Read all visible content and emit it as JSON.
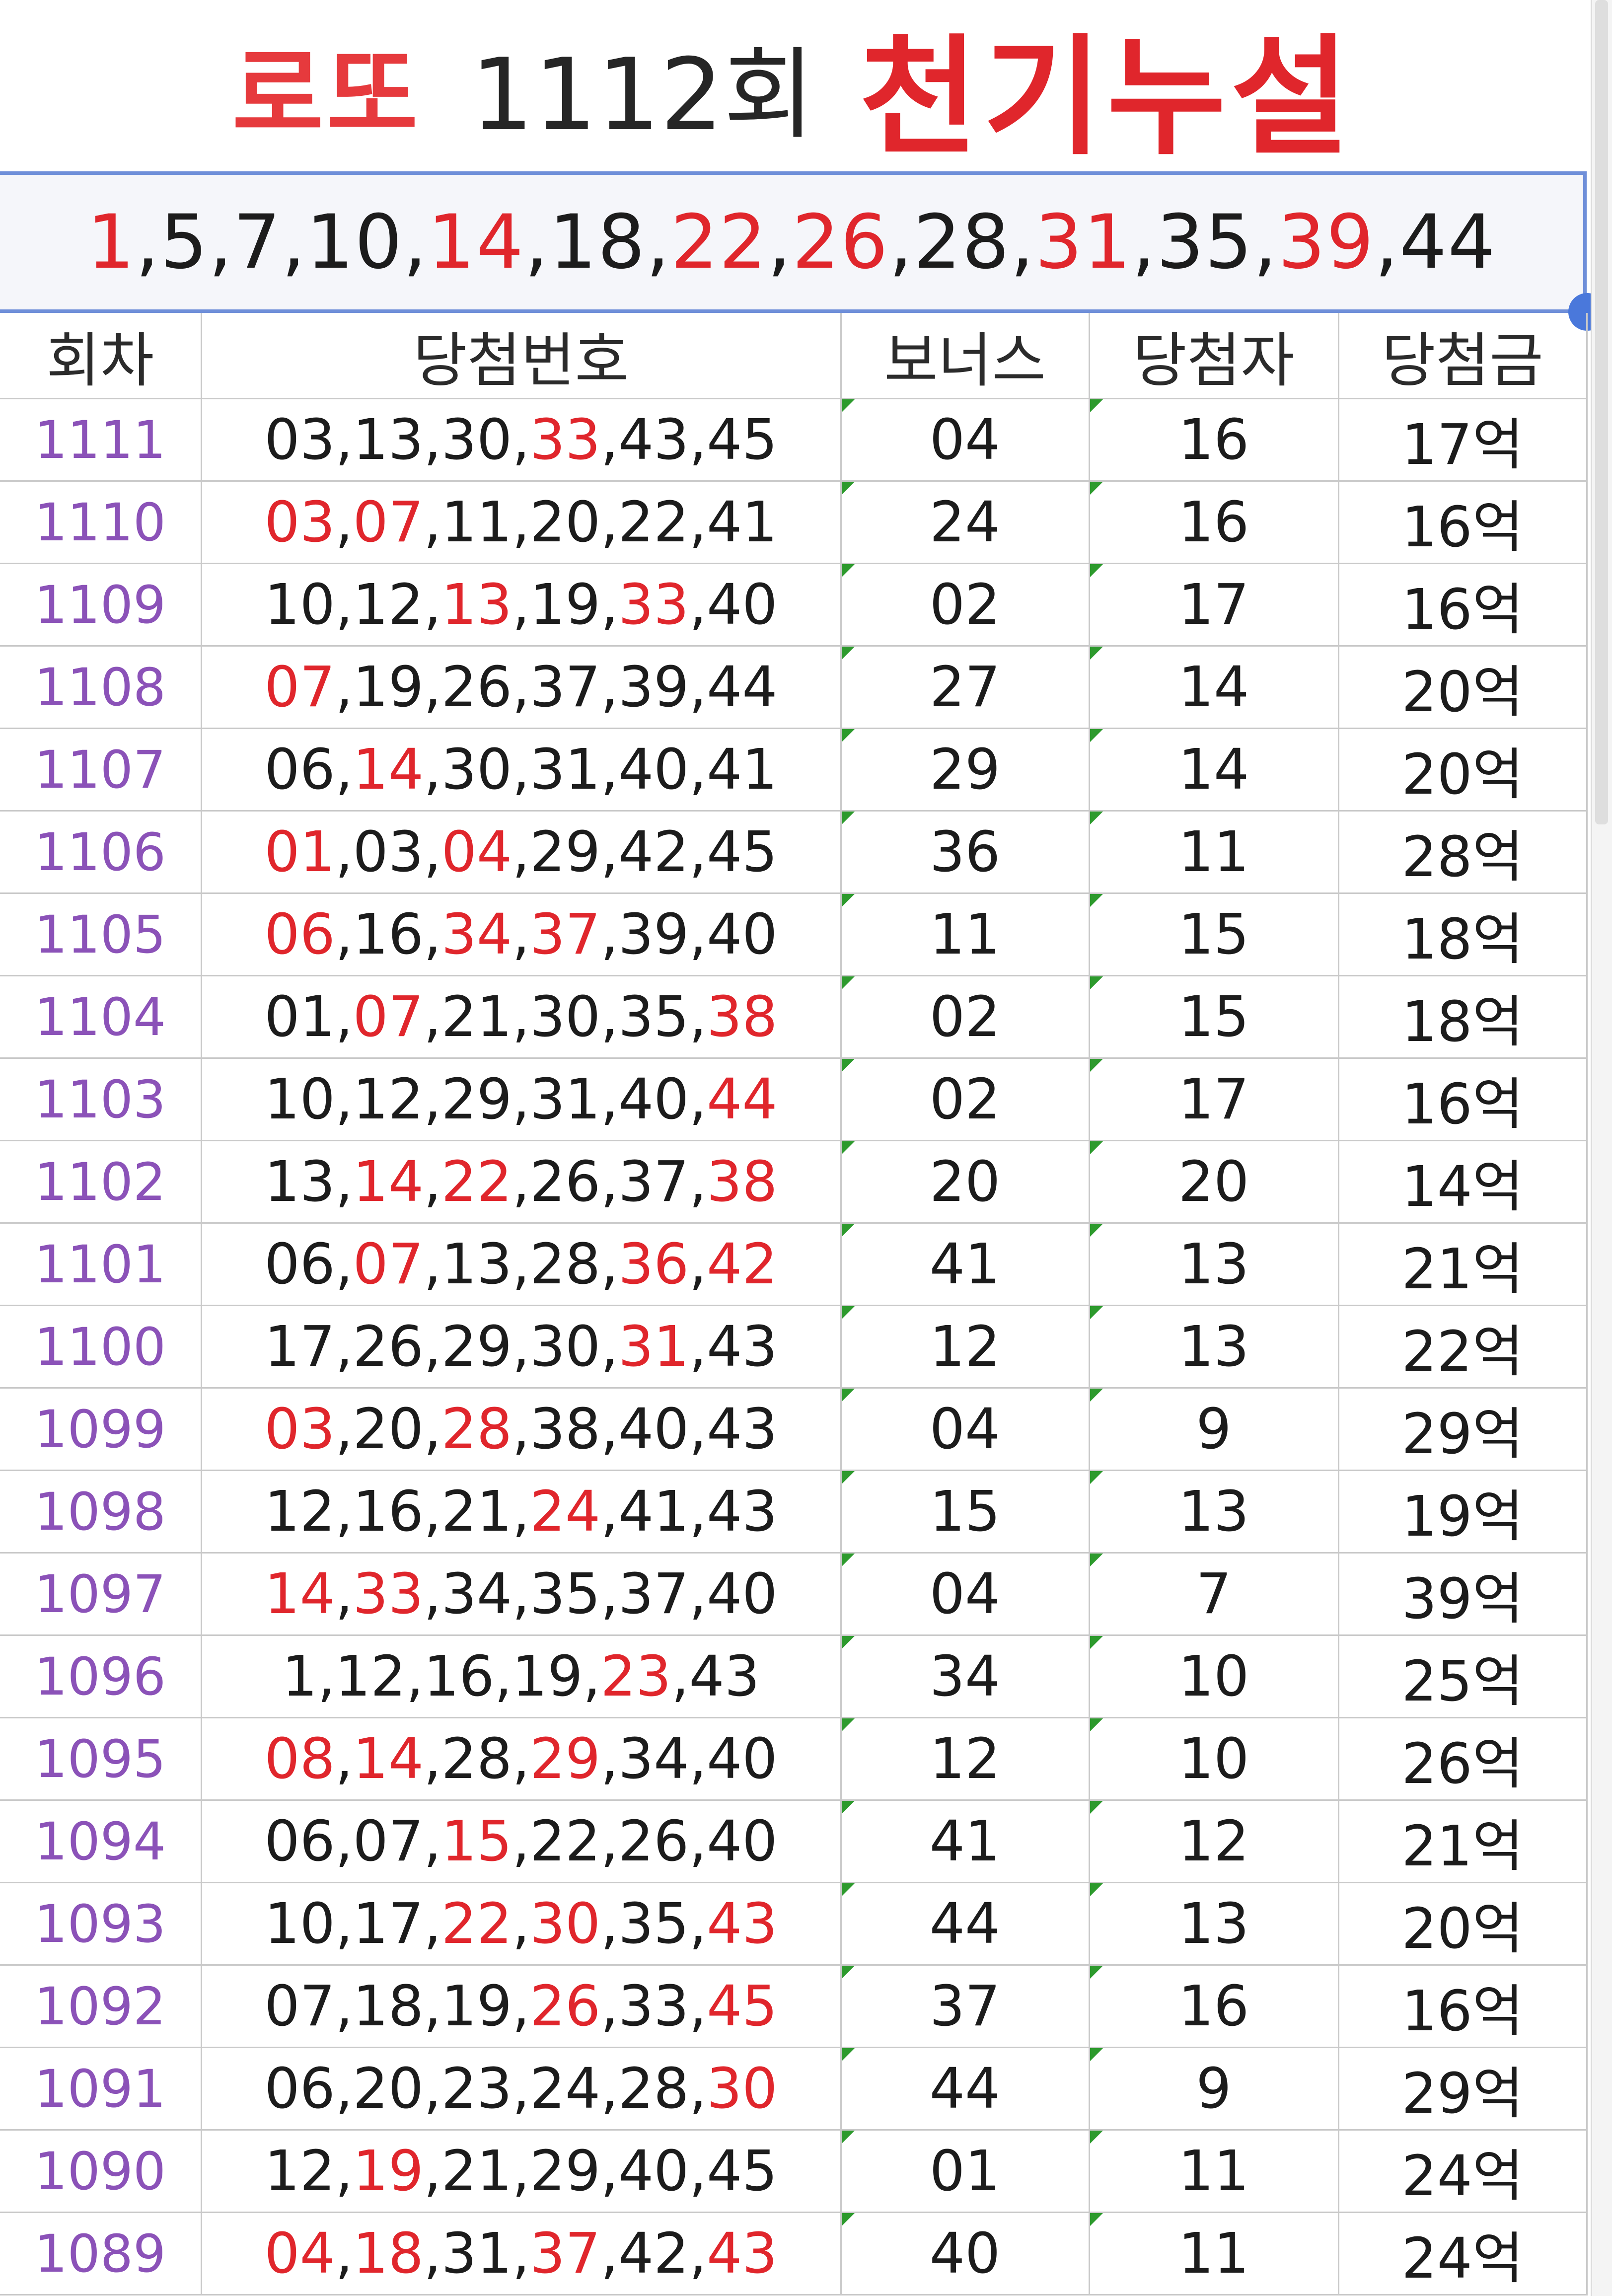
{
  "title": {
    "prefix": "로또",
    "round": "1112회",
    "main": "천기누설"
  },
  "picks": [
    {
      "n": "1",
      "red": true
    },
    {
      "n": "5",
      "red": false
    },
    {
      "n": "7",
      "red": false
    },
    {
      "n": "10",
      "red": false
    },
    {
      "n": "14",
      "red": true
    },
    {
      "n": "18",
      "red": false
    },
    {
      "n": "22",
      "red": true
    },
    {
      "n": "26",
      "red": true
    },
    {
      "n": "28",
      "red": false
    },
    {
      "n": "31",
      "red": true
    },
    {
      "n": "35",
      "red": false
    },
    {
      "n": "39",
      "red": true
    },
    {
      "n": "44",
      "red": false
    }
  ],
  "table": {
    "headers": [
      "회차",
      "당첨번호",
      "보너스",
      "당첨자",
      "당첨금"
    ],
    "rows": [
      {
        "round": "1111",
        "nums": [
          "03",
          "13",
          "30",
          "33",
          "43",
          "45"
        ],
        "red": [
          3
        ],
        "bonus": "04",
        "bonus_red": true,
        "winners": "16",
        "prize": "17억"
      },
      {
        "round": "1110",
        "nums": [
          "03",
          "07",
          "11",
          "20",
          "22",
          "41"
        ],
        "red": [
          0,
          1
        ],
        "bonus": "24",
        "bonus_red": false,
        "winners": "16",
        "prize": "16억"
      },
      {
        "round": "1109",
        "nums": [
          "10",
          "12",
          "13",
          "19",
          "33",
          "40"
        ],
        "red": [
          2,
          4
        ],
        "bonus": "02",
        "bonus_red": true,
        "winners": "17",
        "prize": "16억"
      },
      {
        "round": "1108",
        "nums": [
          "07",
          "19",
          "26",
          "37",
          "39",
          "44"
        ],
        "red": [
          0
        ],
        "bonus": "27",
        "bonus_red": true,
        "winners": "14",
        "prize": "20억"
      },
      {
        "round": "1107",
        "nums": [
          "06",
          "14",
          "30",
          "31",
          "40",
          "41"
        ],
        "red": [
          1
        ],
        "bonus": "29",
        "bonus_red": false,
        "winners": "14",
        "prize": "20억"
      },
      {
        "round": "1106",
        "nums": [
          "01",
          "03",
          "04",
          "29",
          "42",
          "45"
        ],
        "red": [
          0,
          2
        ],
        "bonus": "36",
        "bonus_red": true,
        "winners": "11",
        "prize": "28억"
      },
      {
        "round": "1105",
        "nums": [
          "06",
          "16",
          "34",
          "37",
          "39",
          "40"
        ],
        "red": [
          0,
          2,
          3
        ],
        "bonus": "11",
        "bonus_red": true,
        "winners": "15",
        "prize": "18억"
      },
      {
        "round": "1104",
        "nums": [
          "01",
          "07",
          "21",
          "30",
          "35",
          "38"
        ],
        "red": [
          1,
          5
        ],
        "bonus": "02",
        "bonus_red": true,
        "winners": "15",
        "prize": "18억"
      },
      {
        "round": "1103",
        "nums": [
          "10",
          "12",
          "29",
          "31",
          "40",
          "44"
        ],
        "red": [
          5
        ],
        "bonus": "02",
        "bonus_red": false,
        "winners": "17",
        "prize": "16억"
      },
      {
        "round": "1102",
        "nums": [
          "13",
          "14",
          "22",
          "26",
          "37",
          "38"
        ],
        "red": [
          1,
          2,
          5
        ],
        "bonus": "20",
        "bonus_red": false,
        "winners": "20",
        "prize": "14억"
      },
      {
        "round": "1101",
        "nums": [
          "06",
          "07",
          "13",
          "28",
          "36",
          "42"
        ],
        "red": [
          1,
          4,
          5
        ],
        "bonus": "41",
        "bonus_red": false,
        "winners": "13",
        "prize": "21억"
      },
      {
        "round": "1100",
        "nums": [
          "17",
          "26",
          "29",
          "30",
          "31",
          "43"
        ],
        "red": [
          4
        ],
        "bonus": "12",
        "bonus_red": false,
        "winners": "13",
        "prize": "22억"
      },
      {
        "round": "1099",
        "nums": [
          "03",
          "20",
          "28",
          "38",
          "40",
          "43"
        ],
        "red": [
          0,
          2
        ],
        "bonus": "04",
        "bonus_red": false,
        "winners": "9",
        "prize": "29억"
      },
      {
        "round": "1098",
        "nums": [
          "12",
          "16",
          "21",
          "24",
          "41",
          "43"
        ],
        "red": [
          3
        ],
        "bonus": "15",
        "bonus_red": true,
        "winners": "13",
        "prize": "19억"
      },
      {
        "round": "1097",
        "nums": [
          "14",
          "33",
          "34",
          "35",
          "37",
          "40"
        ],
        "red": [
          0,
          1
        ],
        "bonus": "04",
        "bonus_red": false,
        "winners": "7",
        "prize": "39억"
      },
      {
        "round": "1096",
        "nums": [
          "1",
          "12",
          "16",
          "19",
          "23",
          "43"
        ],
        "red": [
          4
        ],
        "bonus": "34",
        "bonus_red": false,
        "winners": "10",
        "prize": "25억"
      },
      {
        "round": "1095",
        "nums": [
          "08",
          "14",
          "28",
          "29",
          "34",
          "40"
        ],
        "red": [
          0,
          1,
          3
        ],
        "bonus": "12",
        "bonus_red": false,
        "winners": "10",
        "prize": "26억"
      },
      {
        "round": "1094",
        "nums": [
          "06",
          "07",
          "15",
          "22",
          "26",
          "40"
        ],
        "red": [
          2
        ],
        "bonus": "41",
        "bonus_red": true,
        "winners": "12",
        "prize": "21억"
      },
      {
        "round": "1093",
        "nums": [
          "10",
          "17",
          "22",
          "30",
          "35",
          "43"
        ],
        "red": [
          2,
          3,
          5
        ],
        "bonus": "44",
        "bonus_red": false,
        "winners": "13",
        "prize": "20억"
      },
      {
        "round": "1092",
        "nums": [
          "07",
          "18",
          "19",
          "26",
          "33",
          "45"
        ],
        "red": [
          3,
          5
        ],
        "bonus": "37",
        "bonus_red": false,
        "winners": "16",
        "prize": "16억"
      },
      {
        "round": "1091",
        "nums": [
          "06",
          "20",
          "23",
          "24",
          "28",
          "30"
        ],
        "red": [
          5
        ],
        "bonus": "44",
        "bonus_red": false,
        "winners": "9",
        "prize": "29억"
      },
      {
        "round": "1090",
        "nums": [
          "12",
          "19",
          "21",
          "29",
          "40",
          "45"
        ],
        "red": [
          1
        ],
        "bonus": "01",
        "bonus_red": false,
        "winners": "11",
        "prize": "24억"
      },
      {
        "round": "1089",
        "nums": [
          "04",
          "18",
          "31",
          "37",
          "42",
          "43"
        ],
        "red": [
          0,
          1,
          3,
          5
        ],
        "bonus": "40",
        "bonus_red": false,
        "winners": "11",
        "prize": "24억"
      }
    ]
  }
}
